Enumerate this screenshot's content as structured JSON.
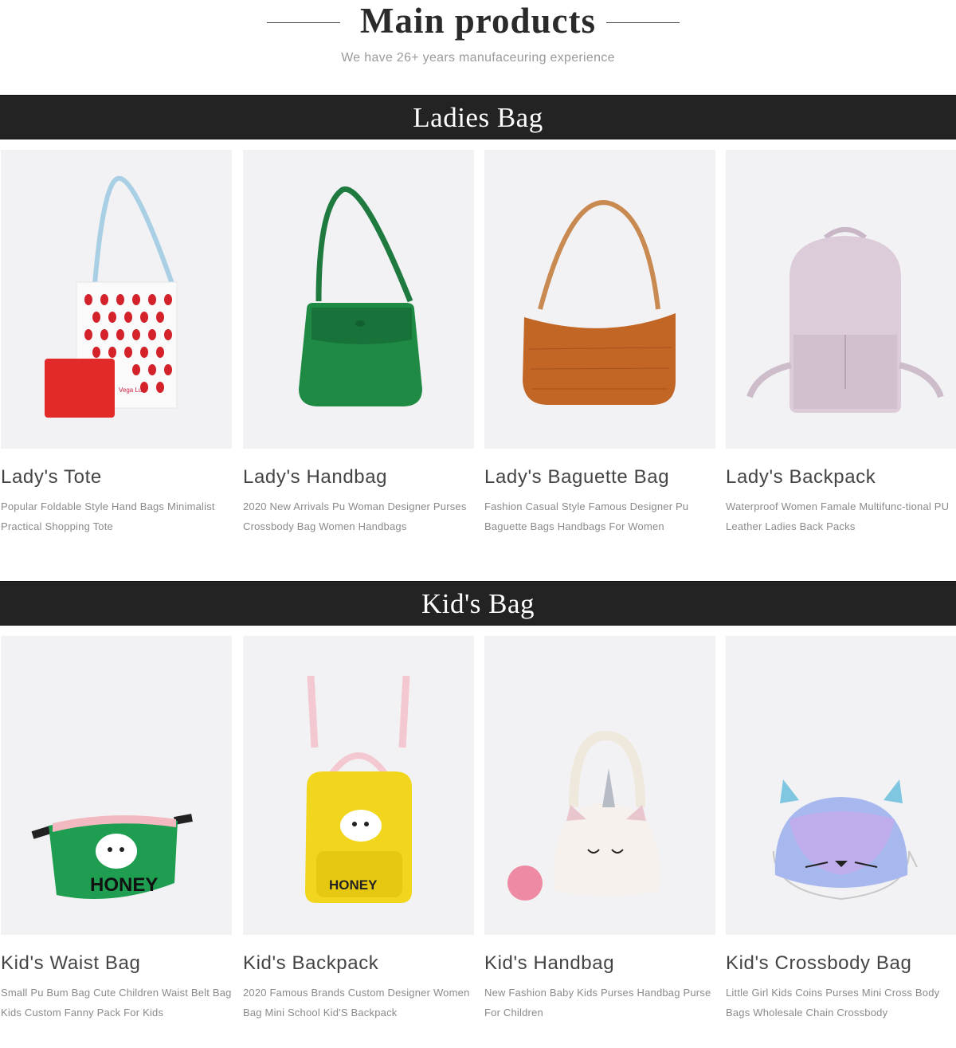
{
  "header": {
    "title": "Main products",
    "subtitle": "We have 26+ years manufaceuring experience"
  },
  "sections": [
    {
      "title": "Ladies Bag",
      "products": [
        {
          "name": "Lady's Tote",
          "desc": "Popular Foldable Style Hand Bags Minimalist Practical Shopping Tote",
          "image_icon": "tote-bag-icon"
        },
        {
          "name": "Lady's Handbag",
          "desc": "2020 New Arrivals Pu Woman Designer Purses Crossbody Bag Women Handbags",
          "image_icon": "green-handbag-icon"
        },
        {
          "name": "Lady's Baguette Bag",
          "desc": "Fashion Casual Style Famous Designer Pu Baguette Bags Handbags For Women",
          "image_icon": "baguette-bag-icon"
        },
        {
          "name": "Lady's Backpack",
          "desc": "Waterproof Women Famale Multifunc-tional PU Leather Ladies Back Packs",
          "image_icon": "backpack-icon"
        }
      ]
    },
    {
      "title": "Kid's Bag",
      "products": [
        {
          "name": "Kid's Waist Bag",
          "desc": "Small Pu Bum Bag Cute Children Waist Belt Bag Kids Custom Fanny Pack For Kids",
          "image_icon": "waist-bag-icon"
        },
        {
          "name": "Kid's Backpack",
          "desc": "2020 Famous Brands Custom Designer Women Bag Mini School Kid'S Backpack",
          "image_icon": "kids-backpack-icon"
        },
        {
          "name": "Kid's Handbag",
          "desc": "New Fashion Baby Kids Purses Handbag Purse For Children",
          "image_icon": "unicorn-handbag-icon"
        },
        {
          "name": "Kid's Crossbody Bag",
          "desc": "Little Girl Kids Coins Purses Mini Cross Body Bags Wholesale Chain Crossbody",
          "image_icon": "cat-crossbody-icon"
        }
      ]
    }
  ],
  "image_text": {
    "tote_brand": "Vega Lu",
    "honey": "HONEY"
  },
  "colors": {
    "band": "#232323",
    "card_bg": "#f2f2f4"
  }
}
